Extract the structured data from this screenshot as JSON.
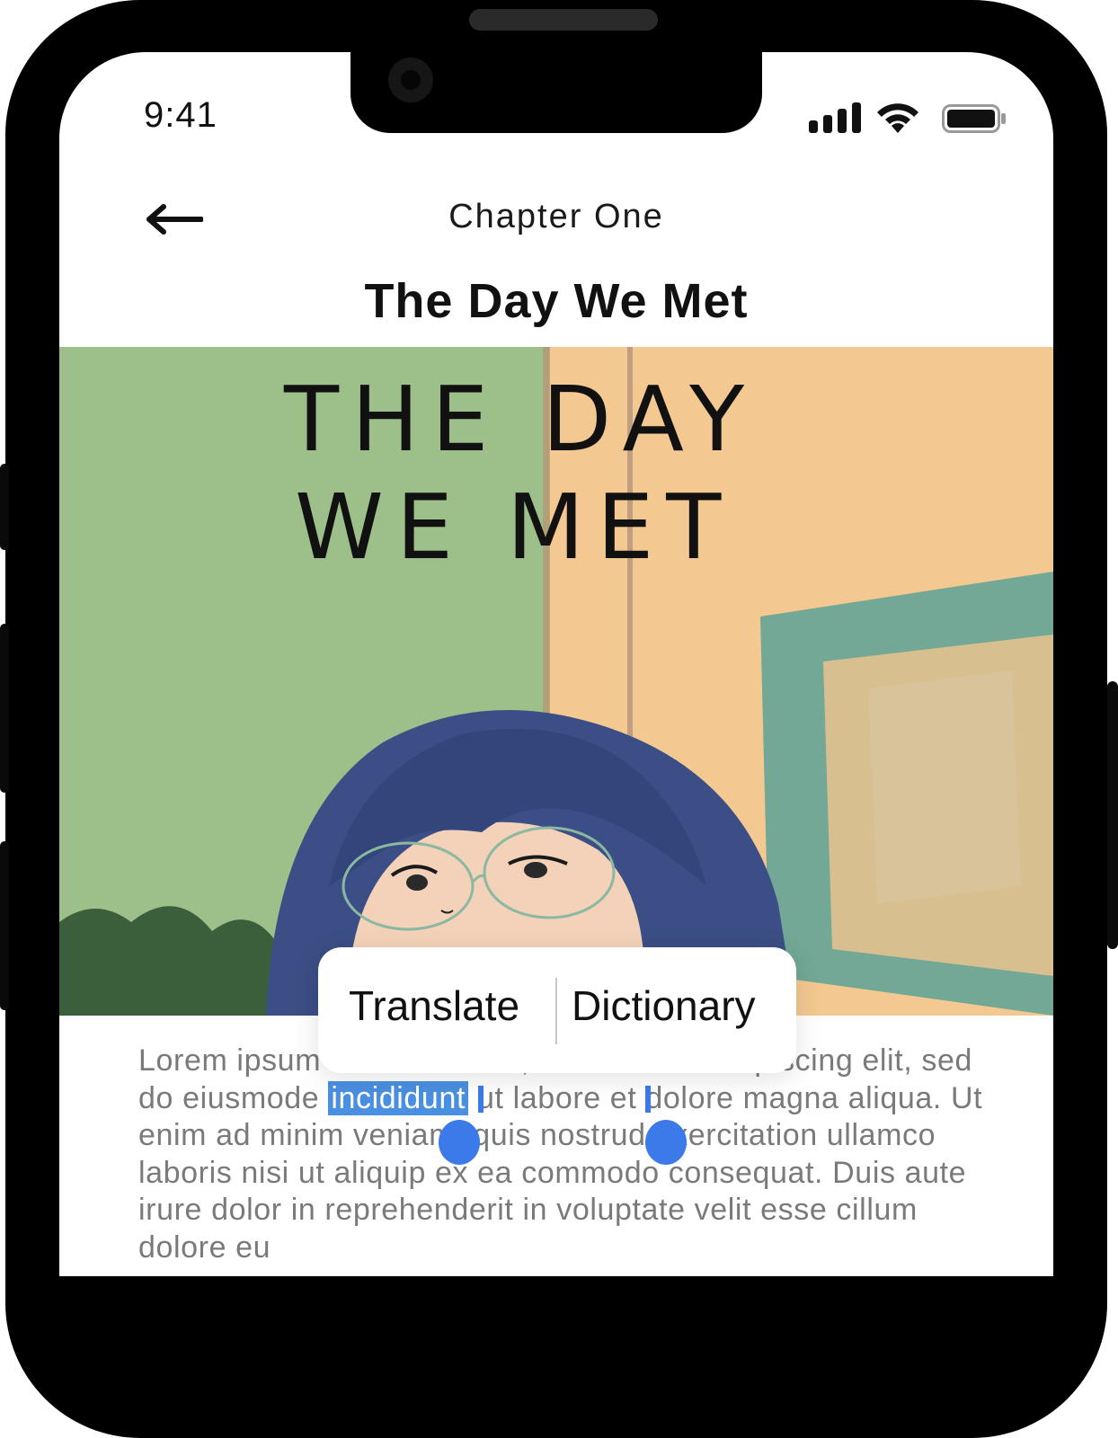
{
  "status_bar": {
    "time": "9:41"
  },
  "header": {
    "back_icon": "arrow-left-icon",
    "chapter": "Chapter One",
    "title": "The Day We Met"
  },
  "cover": {
    "line1": "THE DAY",
    "line2": "WE MET"
  },
  "selection_menu": {
    "translate": "Translate",
    "dictionary": "Dictionary"
  },
  "body": {
    "before": "Lorem ipsum dolor sit amet, consectetur adipiscing elit, sed do eiusmode ",
    "selected": "incididunt",
    "after": " ut labore et dolore magna aliqua. Ut enim ad minim veniam, quis nostrud exercitation ullamco laboris nisi ut aliquip ex ea commodo consequat. Duis aute irure dolor in reprehenderit in voluptate velit esse cillum dolore eu"
  },
  "colors": {
    "selection": "#4a90e2",
    "handle": "#3b7ae8",
    "cover_green": "#9dbf8a",
    "cover_peach": "#f3c891",
    "hair": "#3b4f86"
  }
}
